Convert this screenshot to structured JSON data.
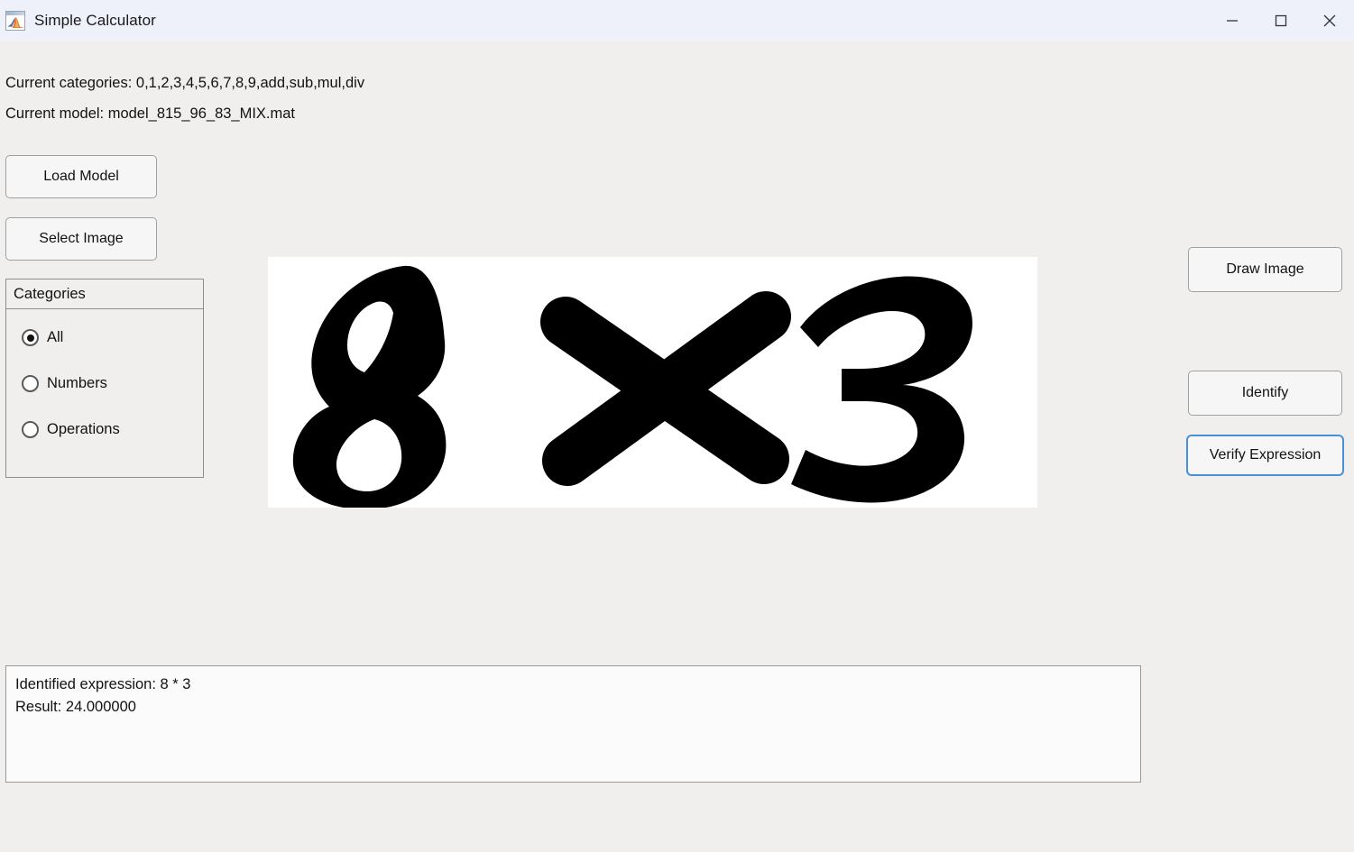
{
  "window": {
    "title": "Simple Calculator",
    "icon": "matlab-app-icon",
    "controls": {
      "minimize": "minimize-icon",
      "maximize": "maximize-icon",
      "close": "close-icon"
    },
    "titlebar_color": "#eef1fa",
    "background_color": "#f0efee"
  },
  "header": {
    "categories_line": "Current categories: 0,1,2,3,4,5,6,7,8,9,add,sub,mul,div",
    "model_line": "Current model: model_815_96_83_MIX.mat"
  },
  "left_buttons": {
    "load_model": "Load Model",
    "select_image": "Select Image"
  },
  "categories_panel": {
    "title": "Categories",
    "options": [
      {
        "label": "All",
        "selected": true
      },
      {
        "label": "Numbers",
        "selected": false
      },
      {
        "label": "Operations",
        "selected": false
      }
    ]
  },
  "right_buttons": {
    "draw_image": "Draw Image",
    "identify": "Identify",
    "verify_expression": "Verify Expression",
    "focused": "Verify Expression",
    "focus_color": "#4a90d9"
  },
  "image_preview": {
    "description": "handwritten expression 8 x 3",
    "background_color": "#ffffff",
    "ink_color": "#000000",
    "characters": [
      "8",
      "x",
      "3"
    ]
  },
  "output": {
    "lines": [
      "Identified expression: 8 * 3",
      "Result: 24.000000"
    ],
    "expression": "8 * 3",
    "result": "24.000000",
    "background_color": "#fbfbfb"
  }
}
